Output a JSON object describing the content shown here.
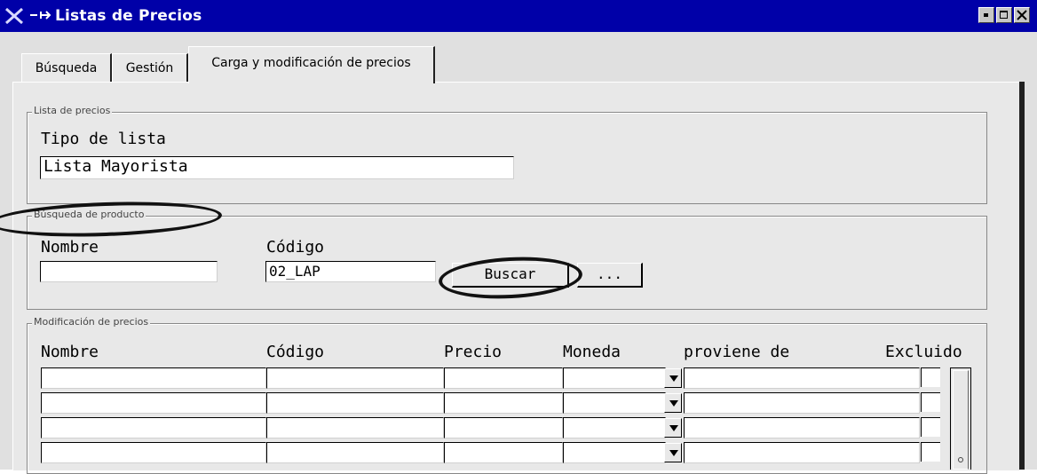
{
  "window": {
    "title": "Listas de Precios",
    "controls": [
      "minimize-icon",
      "maximize-icon",
      "close-icon"
    ]
  },
  "tabs": [
    {
      "label": "Búsqueda",
      "active": false
    },
    {
      "label": "Gestión",
      "active": false
    },
    {
      "label": "Carga y modificación de precios",
      "active": true
    }
  ],
  "lista_precios": {
    "legend": "Lista de precios",
    "tipo_label": "Tipo de lista",
    "tipo_value": "Lista Mayorista"
  },
  "busqueda_producto": {
    "legend": "Búsqueda de producto",
    "nombre_label": "Nombre",
    "nombre_value": "",
    "codigo_label": "Código",
    "codigo_value": "02_LAP",
    "buscar_label": "Buscar",
    "more_label": "..."
  },
  "modificacion": {
    "legend": "Modificación de precios",
    "columns": [
      "Nombre",
      "Código",
      "Precio",
      "Moneda",
      "proviene de",
      "Excluido"
    ],
    "rows": [
      {
        "nombre": "",
        "codigo": "",
        "precio": "",
        "moneda": "",
        "proviene": "",
        "excluido": false
      },
      {
        "nombre": "",
        "codigo": "",
        "precio": "",
        "moneda": "",
        "proviene": "",
        "excluido": false
      },
      {
        "nombre": "",
        "codigo": "",
        "precio": "",
        "moneda": "",
        "proviene": "",
        "excluido": false
      },
      {
        "nombre": "",
        "codigo": "",
        "precio": "",
        "moneda": "",
        "proviene": "",
        "excluido": false
      }
    ]
  },
  "colors": {
    "titlebar": "#0000a8",
    "window": "#e0e0e0",
    "annotation": "#111111"
  }
}
